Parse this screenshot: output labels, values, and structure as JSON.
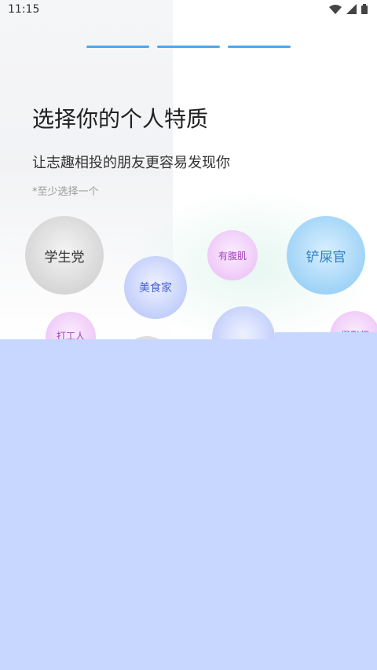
{
  "status_bar": {
    "time": "11:15",
    "icons": [
      "wifi-icon",
      "signal-icon",
      "battery-icon"
    ]
  },
  "progress": {
    "steps": 3
  },
  "header": {
    "title": "选择你的个人特质",
    "subtitle": "让志趣相投的朋友更容易发现你",
    "hint": "*至少选择一个"
  },
  "bubbles": [
    {
      "label": "学生党"
    },
    {
      "label": "美食家"
    },
    {
      "label": "有腹肌"
    },
    {
      "label": "铲屎官"
    },
    {
      "label": "打工人"
    },
    {
      "label": ""
    },
    {
      "label": ""
    },
    {
      "label": "摄影师"
    }
  ],
  "colors": {
    "accent": "#4aa8ef",
    "overlay": "#c7d7ff"
  }
}
